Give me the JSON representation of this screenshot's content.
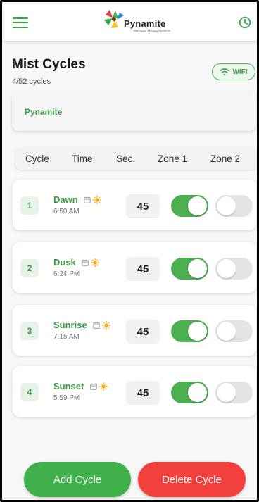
{
  "header": {
    "logo_text": "Pynamite",
    "logo_sub": "Mosquito Misting Systems"
  },
  "page": {
    "title": "Mist Cycles",
    "count_label": "4/52 cycles",
    "wifi_label": "WIFI"
  },
  "device": {
    "name": "Pynamite"
  },
  "columns": [
    "Cycle",
    "Time",
    "Sec.",
    "Zone 1",
    "Zone 2"
  ],
  "cycles": [
    {
      "number": "1",
      "name": "Dawn",
      "time": "6:50 AM",
      "seconds": "45",
      "zone1_on": true,
      "zone2_on": false
    },
    {
      "number": "2",
      "name": "Dusk",
      "time": "6:24 PM",
      "seconds": "45",
      "zone1_on": true,
      "zone2_on": false
    },
    {
      "number": "3",
      "name": "Sunrise",
      "time": "7:15 AM",
      "seconds": "45",
      "zone1_on": true,
      "zone2_on": false
    },
    {
      "number": "4",
      "name": "Sunset",
      "time": "5:59 PM",
      "seconds": "45",
      "zone1_on": true,
      "zone2_on": false
    }
  ],
  "actions": {
    "add_label": "Add Cycle",
    "delete_label": "Delete Cycle"
  },
  "colors": {
    "accent_green": "#3d9a44",
    "toggle_on": "#4caf50",
    "add_button": "#3fb04a",
    "delete_button": "#f2403d"
  },
  "icons": {
    "menu": "hamburger-menu-icon",
    "history": "clock-icon",
    "wifi": "wifi-icon",
    "schedule": "calendar-icon",
    "solar": "sun-icon"
  }
}
